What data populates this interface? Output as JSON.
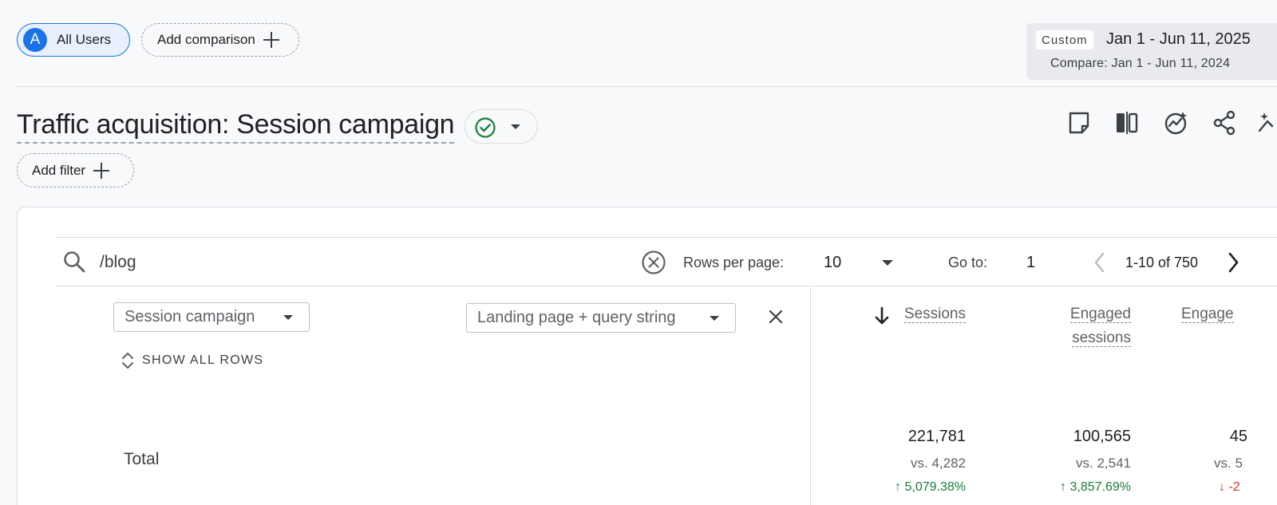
{
  "header": {
    "segment": {
      "avatar_letter": "A",
      "label": "All Users"
    },
    "add_comparison": "Add comparison",
    "date": {
      "range_type": "Custom",
      "range": "Jan 1 - Jun 11, 2025",
      "compare": "Compare: Jan 1 - Jun 11, 2024"
    }
  },
  "report": {
    "title": "Traffic acquisition: Session campaign",
    "add_filter": "Add filter",
    "toolbar_icons": [
      "note-icon",
      "compare-columns-icon",
      "insights-icon",
      "share-icon",
      "magic-wand-icon"
    ]
  },
  "table_controls": {
    "search_value": "/blog",
    "rows_per_page_label": "Rows per page:",
    "rows_per_page": "10",
    "goto_label": "Go to:",
    "goto_value": "1",
    "page_range": "1-10 of 750"
  },
  "table": {
    "primary_dimension": "Session campaign",
    "secondary_dimension": "Landing page + query string",
    "show_all_rows": "SHOW ALL ROWS",
    "columns": [
      {
        "line1": "Sessions",
        "line2": ""
      },
      {
        "line1": "Engaged",
        "line2": "sessions"
      },
      {
        "line1": "Engage",
        "line2": ""
      }
    ],
    "total": {
      "label": "Total",
      "values": [
        {
          "value": "221,781",
          "vs": "vs. 4,282",
          "change": "5,079.38%",
          "direction": "up"
        },
        {
          "value": "100,565",
          "vs": "vs. 2,541",
          "change": "3,857.69%",
          "direction": "up"
        },
        {
          "value": "45",
          "vs": "vs. 5",
          "change": "-2",
          "direction": "down"
        }
      ]
    }
  },
  "colors": {
    "accent": "#1a73e8",
    "positive": "#188038",
    "negative": "#d93025"
  }
}
